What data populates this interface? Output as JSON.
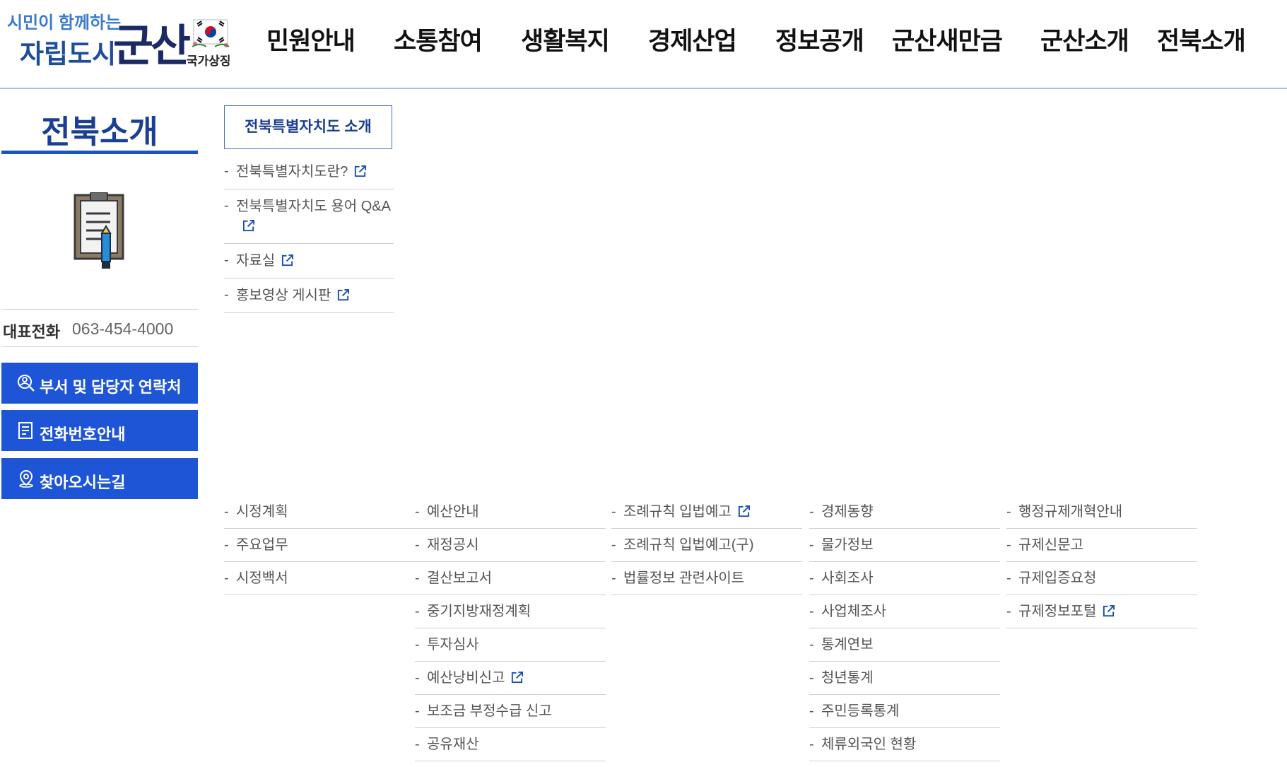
{
  "header": {
    "slogan_small": "시민이 함께하는",
    "slogan_big": "자립도시",
    "brand": "군산",
    "flag_caption": "국가상징",
    "nav": [
      "민원안내",
      "소통참여",
      "생활복지",
      "경제산업",
      "정보공개",
      "군산새만금",
      "군산소개",
      "전북소개"
    ]
  },
  "sidebar": {
    "title": "전북소개",
    "phone_label": "대표전화",
    "phone_number": "063-454-4000",
    "buttons": [
      "부서 및 담당자 연락처",
      "전화번호안내",
      "찾아오시는길"
    ]
  },
  "submenu": {
    "heading": "전북특별자치도 소개",
    "items": [
      {
        "label": "전북특별자치도란?",
        "external": true
      },
      {
        "label": "전북특별자치도 용어 Q&A",
        "external": true
      },
      {
        "label": "자료실",
        "external": true
      },
      {
        "label": "홍보영상 게시판",
        "external": true
      }
    ]
  },
  "columns": [
    [
      {
        "label": "시정계획"
      },
      {
        "label": "주요업무"
      },
      {
        "label": "시정백서"
      }
    ],
    [
      {
        "label": "예산안내"
      },
      {
        "label": "재정공시"
      },
      {
        "label": "결산보고서"
      },
      {
        "label": "중기지방재정계획"
      },
      {
        "label": "투자심사"
      },
      {
        "label": "예산낭비신고",
        "external": true
      },
      {
        "label": "보조금 부정수급 신고"
      },
      {
        "label": "공유재산"
      }
    ],
    [
      {
        "label": "조례규칙 입법예고",
        "external": true
      },
      {
        "label": "조례규칙 입법예고(구)"
      },
      {
        "label": "법률정보 관련사이트"
      }
    ],
    [
      {
        "label": "경제동향"
      },
      {
        "label": "물가정보"
      },
      {
        "label": "사회조사"
      },
      {
        "label": "사업체조사"
      },
      {
        "label": "통계연보"
      },
      {
        "label": "청년통계"
      },
      {
        "label": "주민등록통계"
      },
      {
        "label": "체류외국인 현황"
      }
    ],
    [
      {
        "label": "행정규제개혁안내"
      },
      {
        "label": "규제신문고"
      },
      {
        "label": "규제입증요청"
      },
      {
        "label": "규제정보포털",
        "external": true
      }
    ]
  ],
  "colors": {
    "primary_blue": "#1e55d6",
    "title_navy": "#1a3f93",
    "border_gray": "#cfcfcf"
  }
}
